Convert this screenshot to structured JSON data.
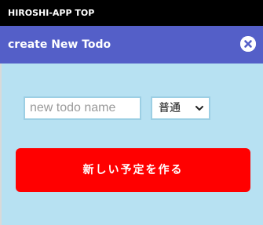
{
  "topbar": {
    "title": "HIROSHI-APP TOP"
  },
  "header": {
    "title": "create New Todo",
    "close_icon": "close-icon"
  },
  "form": {
    "name_placeholder": "new todo name",
    "name_value": "",
    "priority_selected": "普通",
    "submit_label": "新しい予定を作る"
  },
  "colors": {
    "topbar": "#000000",
    "header": "#545fc8",
    "panel": "#b7e1f2",
    "submit": "#ff0000"
  }
}
